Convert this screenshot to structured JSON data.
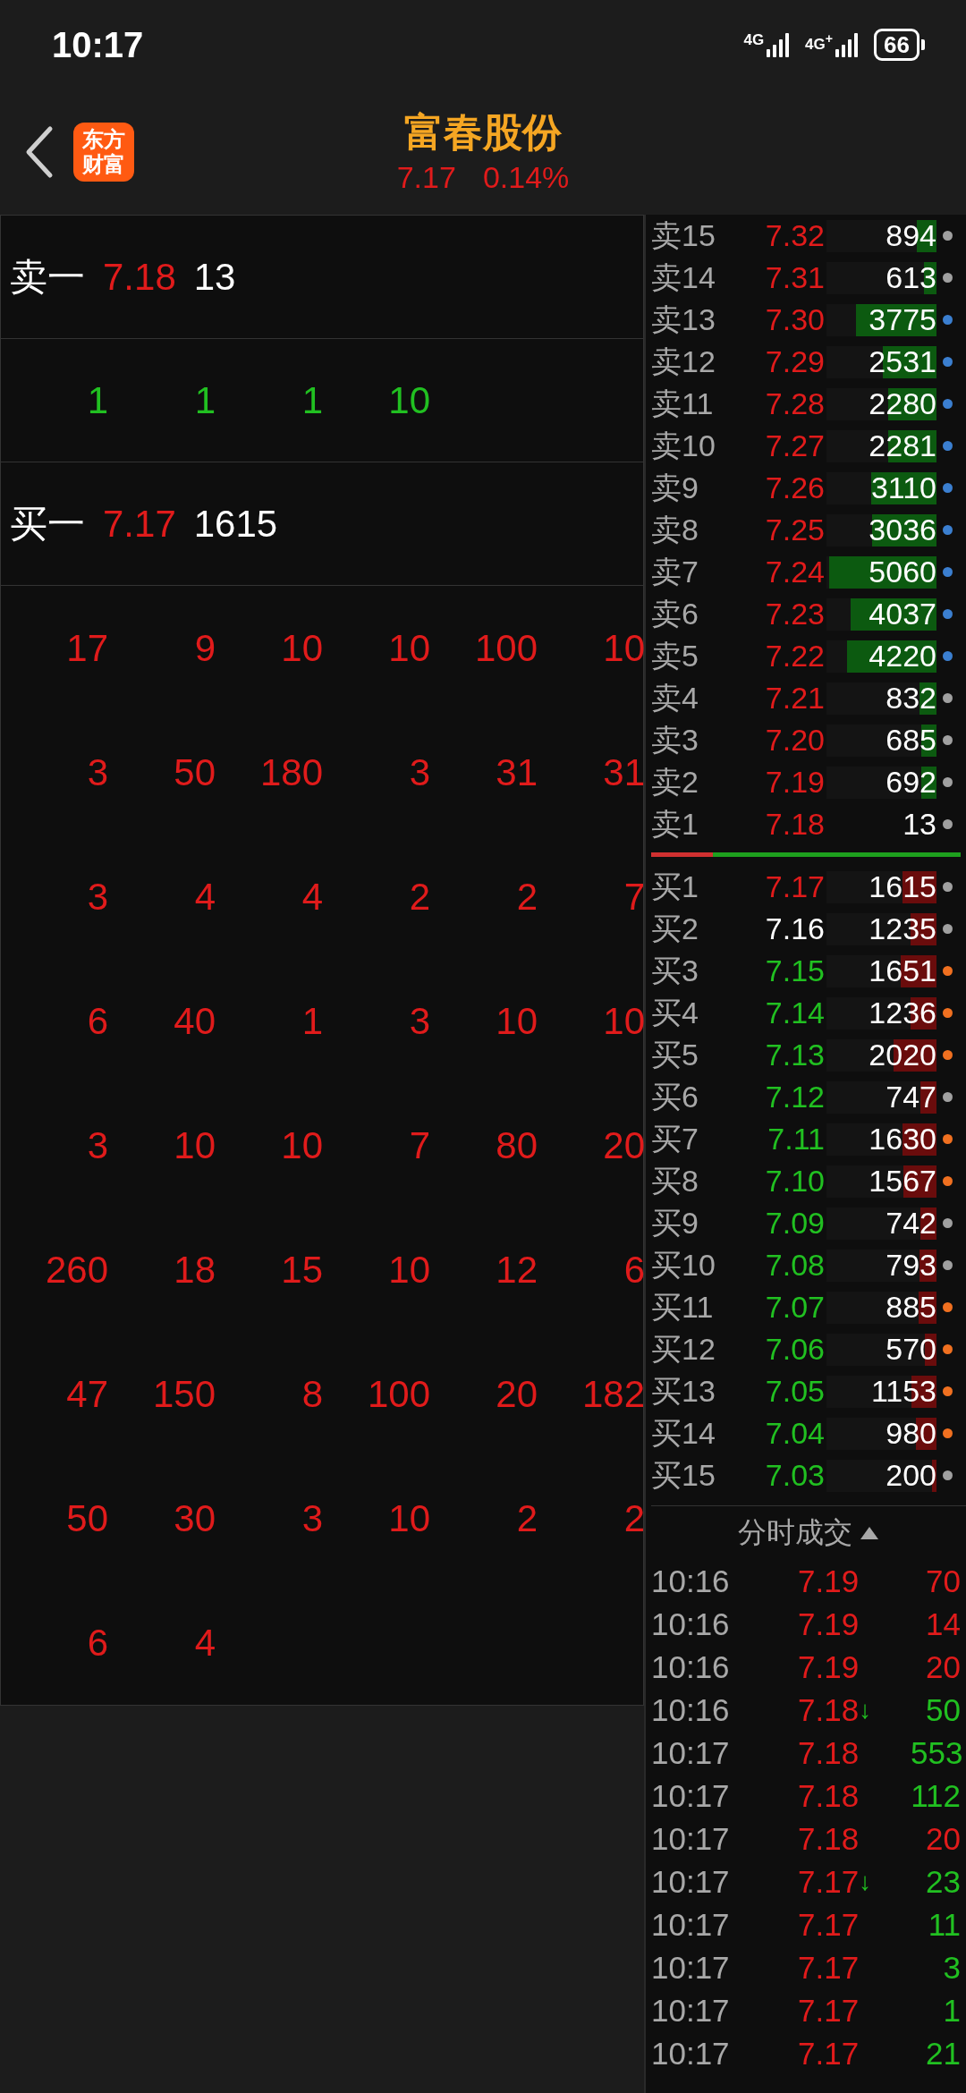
{
  "status_bar": {
    "time": "10:17",
    "networks": [
      "4G",
      "4G$^{+}$"
    ],
    "battery": "66"
  },
  "header": {
    "logo_lines": [
      "东方",
      "财富"
    ],
    "title": "富春股份",
    "price": "7.17",
    "change": "0.14%"
  },
  "queue": {
    "ask": {
      "label": "卖一",
      "price": "7.18",
      "volume": "13"
    },
    "fills": [
      "1",
      "1",
      "1",
      "10"
    ],
    "bid": {
      "label": "买一",
      "price": "7.17",
      "volume": "1615"
    },
    "orders": [
      [
        "17",
        "9",
        "10",
        "10",
        "100",
        "10"
      ],
      [
        "3",
        "50",
        "180",
        "3",
        "31",
        "31"
      ],
      [
        "3",
        "4",
        "4",
        "2",
        "2",
        "7"
      ],
      [
        "6",
        "40",
        "1",
        "3",
        "10",
        "10"
      ],
      [
        "3",
        "10",
        "10",
        "7",
        "80",
        "20"
      ],
      [
        "260",
        "18",
        "15",
        "10",
        "12",
        "6"
      ],
      [
        "47",
        "150",
        "8",
        "100",
        "20",
        "182"
      ],
      [
        "50",
        "30",
        "3",
        "10",
        "2",
        "2"
      ],
      [
        "6",
        "4"
      ]
    ]
  },
  "order_book": {
    "asks": [
      {
        "label": "卖15",
        "price": {
          "text": "7.32",
          "color": "#e01b1b"
        },
        "volume": "894",
        "level": 0.18,
        "color": "#a0a0a0"
      },
      {
        "label": "卖14",
        "price": {
          "text": "7.31",
          "color": "#e01b1b"
        },
        "volume": "613",
        "level": 0.12,
        "color": "#a0a0a0"
      },
      {
        "label": "卖13",
        "price": {
          "text": "7.30",
          "color": "#e01b1b"
        },
        "volume": "3775",
        "level": 0.75,
        "color": "#3b7fd0"
      },
      {
        "label": "卖12",
        "price": {
          "text": "7.29",
          "color": "#e01b1b"
        },
        "volume": "2531",
        "level": 0.5,
        "color": "#3b7fd0"
      },
      {
        "label": "卖11",
        "price": {
          "text": "7.28",
          "color": "#e01b1b"
        },
        "volume": "2280",
        "level": 0.45,
        "color": "#3b7fd0"
      },
      {
        "label": "卖10",
        "price": {
          "text": "7.27",
          "color": "#e01b1b"
        },
        "volume": "2281",
        "level": 0.45,
        "color": "#3b7fd0"
      },
      {
        "label": "卖9",
        "price": {
          "text": "7.26",
          "color": "#e01b1b"
        },
        "volume": "3110",
        "level": 0.61,
        "color": "#3b7fd0"
      },
      {
        "label": "卖8",
        "price": {
          "text": "7.25",
          "color": "#e01b1b"
        },
        "volume": "3036",
        "level": 0.6,
        "color": "#3b7fd0"
      },
      {
        "label": "卖7",
        "price": {
          "text": "7.24",
          "color": "#e01b1b"
        },
        "volume": "5060",
        "level": 1.0,
        "color": "#3b7fd0"
      },
      {
        "label": "卖6",
        "price": {
          "text": "7.23",
          "color": "#e01b1b"
        },
        "volume": "4037",
        "level": 0.8,
        "color": "#3b7fd0"
      },
      {
        "label": "卖5",
        "price": {
          "text": "7.22",
          "color": "#e01b1b"
        },
        "volume": "4220",
        "level": 0.83,
        "color": "#3b7fd0"
      },
      {
        "label": "卖4",
        "price": {
          "text": "7.21",
          "color": "#e01b1b"
        },
        "volume": "832",
        "level": 0.16,
        "color": "#a0a0a0"
      },
      {
        "label": "卖3",
        "price": {
          "text": "7.20",
          "color": "#e01b1b"
        },
        "volume": "685",
        "level": 0.14,
        "color": "#a0a0a0"
      },
      {
        "label": "卖2",
        "price": {
          "text": "7.19",
          "color": "#e01b1b"
        },
        "volume": "692",
        "level": 0.14,
        "color": "#a0a0a0"
      },
      {
        "label": "卖1",
        "price": {
          "text": "7.18",
          "color": "#e01b1b"
        },
        "volume": "13",
        "color": "#a0a0a0"
      }
    ],
    "balance": {
      "level": 0.2
    },
    "bids": [
      {
        "label": "买1",
        "price": {
          "text": "7.17",
          "color": "#e01b1b"
        },
        "volume": "1615",
        "level": 0.32,
        "color": "#a0a0a0"
      },
      {
        "label": "买2",
        "price": {
          "text": "7.16",
          "color": "#ffffff"
        },
        "volume": "1235",
        "level": 0.24,
        "color": "#a0a0a0"
      },
      {
        "label": "买3",
        "price": {
          "text": "7.15",
          "color": "#21c021"
        },
        "volume": "1651",
        "level": 0.33,
        "color": "#f07020"
      },
      {
        "label": "买4",
        "price": {
          "text": "7.14",
          "color": "#21c021"
        },
        "volume": "1236",
        "level": 0.24,
        "color": "#f07020"
      },
      {
        "label": "买5",
        "price": {
          "text": "7.13",
          "color": "#21c021"
        },
        "volume": "2020",
        "level": 0.4,
        "color": "#f07020"
      },
      {
        "label": "买6",
        "price": {
          "text": "7.12",
          "color": "#21c021"
        },
        "volume": "747",
        "level": 0.15,
        "color": "#a0a0a0"
      },
      {
        "label": "买7",
        "price": {
          "text": "7.11",
          "color": "#21c021"
        },
        "volume": "1630",
        "level": 0.32,
        "color": "#f07020"
      },
      {
        "label": "买8",
        "price": {
          "text": "7.10",
          "color": "#21c021"
        },
        "volume": "1567",
        "level": 0.31,
        "color": "#f07020"
      },
      {
        "label": "买9",
        "price": {
          "text": "7.09",
          "color": "#21c021"
        },
        "volume": "742",
        "level": 0.15,
        "color": "#a0a0a0"
      },
      {
        "label": "买10",
        "price": {
          "text": "7.08",
          "color": "#21c021"
        },
        "volume": "793",
        "level": 0.16,
        "color": "#a0a0a0"
      },
      {
        "label": "买11",
        "price": {
          "text": "7.07",
          "color": "#21c021"
        },
        "volume": "885",
        "level": 0.17,
        "color": "#f07020"
      },
      {
        "label": "买12",
        "price": {
          "text": "7.06",
          "color": "#21c021"
        },
        "volume": "570",
        "level": 0.11,
        "color": "#f07020"
      },
      {
        "label": "买13",
        "price": {
          "text": "7.05",
          "color": "#21c021"
        },
        "volume": "1153",
        "level": 0.23,
        "color": "#f07020"
      },
      {
        "label": "买14",
        "price": {
          "text": "7.04",
          "color": "#21c021"
        },
        "volume": "980",
        "level": 0.19,
        "color": "#f07020"
      },
      {
        "label": "买15",
        "price": {
          "text": "7.03",
          "color": "#21c021"
        },
        "volume": "200",
        "level": 0.04,
        "color": "#a0a0a0"
      }
    ]
  },
  "trades": {
    "title": "分时成交",
    "rows": [
      {
        "time": "10:16",
        "price": "7.19",
        "volume": "70",
        "buy": true
      },
      {
        "time": "10:16",
        "price": "7.19",
        "volume": "14",
        "buy": true
      },
      {
        "time": "10:16",
        "price": "7.19",
        "volume": "20",
        "buy": true
      },
      {
        "time": "10:16",
        "price": "7.18",
        "arrow": "↓",
        "volume": "50",
        "buy": false
      },
      {
        "time": "10:17",
        "price": "7.18",
        "volume": "553",
        "buy": false
      },
      {
        "time": "10:17",
        "price": "7.18",
        "volume": "112",
        "buy": false
      },
      {
        "time": "10:17",
        "price": "7.18",
        "volume": "20",
        "buy": true
      },
      {
        "time": "10:17",
        "price": "7.17",
        "arrow": "↓",
        "volume": "23",
        "buy": false
      },
      {
        "time": "10:17",
        "price": "7.17",
        "volume": "11",
        "buy": false
      },
      {
        "time": "10:17",
        "price": "7.17",
        "volume": "3",
        "buy": false
      },
      {
        "time": "10:17",
        "price": "7.17",
        "volume": "1",
        "buy": false
      },
      {
        "time": "10:17",
        "price": "7.17",
        "volume": "21",
        "buy": false
      }
    ]
  }
}
